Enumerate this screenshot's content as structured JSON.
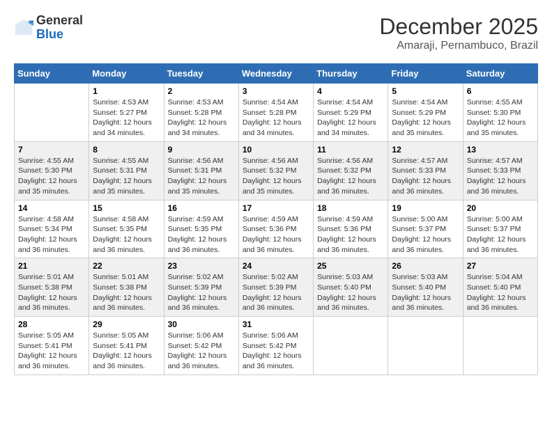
{
  "logo": {
    "general": "General",
    "blue": "Blue"
  },
  "header": {
    "title": "December 2025",
    "subtitle": "Amaraji, Pernambuco, Brazil"
  },
  "days_of_week": [
    "Sunday",
    "Monday",
    "Tuesday",
    "Wednesday",
    "Thursday",
    "Friday",
    "Saturday"
  ],
  "weeks": [
    [
      {
        "day": "",
        "sunrise": "",
        "sunset": "",
        "daylight": ""
      },
      {
        "day": "1",
        "sunrise": "Sunrise: 4:53 AM",
        "sunset": "Sunset: 5:27 PM",
        "daylight": "Daylight: 12 hours and 34 minutes."
      },
      {
        "day": "2",
        "sunrise": "Sunrise: 4:53 AM",
        "sunset": "Sunset: 5:28 PM",
        "daylight": "Daylight: 12 hours and 34 minutes."
      },
      {
        "day": "3",
        "sunrise": "Sunrise: 4:54 AM",
        "sunset": "Sunset: 5:28 PM",
        "daylight": "Daylight: 12 hours and 34 minutes."
      },
      {
        "day": "4",
        "sunrise": "Sunrise: 4:54 AM",
        "sunset": "Sunset: 5:29 PM",
        "daylight": "Daylight: 12 hours and 34 minutes."
      },
      {
        "day": "5",
        "sunrise": "Sunrise: 4:54 AM",
        "sunset": "Sunset: 5:29 PM",
        "daylight": "Daylight: 12 hours and 35 minutes."
      },
      {
        "day": "6",
        "sunrise": "Sunrise: 4:55 AM",
        "sunset": "Sunset: 5:30 PM",
        "daylight": "Daylight: 12 hours and 35 minutes."
      }
    ],
    [
      {
        "day": "7",
        "sunrise": "Sunrise: 4:55 AM",
        "sunset": "Sunset: 5:30 PM",
        "daylight": "Daylight: 12 hours and 35 minutes."
      },
      {
        "day": "8",
        "sunrise": "Sunrise: 4:55 AM",
        "sunset": "Sunset: 5:31 PM",
        "daylight": "Daylight: 12 hours and 35 minutes."
      },
      {
        "day": "9",
        "sunrise": "Sunrise: 4:56 AM",
        "sunset": "Sunset: 5:31 PM",
        "daylight": "Daylight: 12 hours and 35 minutes."
      },
      {
        "day": "10",
        "sunrise": "Sunrise: 4:56 AM",
        "sunset": "Sunset: 5:32 PM",
        "daylight": "Daylight: 12 hours and 35 minutes."
      },
      {
        "day": "11",
        "sunrise": "Sunrise: 4:56 AM",
        "sunset": "Sunset: 5:32 PM",
        "daylight": "Daylight: 12 hours and 36 minutes."
      },
      {
        "day": "12",
        "sunrise": "Sunrise: 4:57 AM",
        "sunset": "Sunset: 5:33 PM",
        "daylight": "Daylight: 12 hours and 36 minutes."
      },
      {
        "day": "13",
        "sunrise": "Sunrise: 4:57 AM",
        "sunset": "Sunset: 5:33 PM",
        "daylight": "Daylight: 12 hours and 36 minutes."
      }
    ],
    [
      {
        "day": "14",
        "sunrise": "Sunrise: 4:58 AM",
        "sunset": "Sunset: 5:34 PM",
        "daylight": "Daylight: 12 hours and 36 minutes."
      },
      {
        "day": "15",
        "sunrise": "Sunrise: 4:58 AM",
        "sunset": "Sunset: 5:35 PM",
        "daylight": "Daylight: 12 hours and 36 minutes."
      },
      {
        "day": "16",
        "sunrise": "Sunrise: 4:59 AM",
        "sunset": "Sunset: 5:35 PM",
        "daylight": "Daylight: 12 hours and 36 minutes."
      },
      {
        "day": "17",
        "sunrise": "Sunrise: 4:59 AM",
        "sunset": "Sunset: 5:36 PM",
        "daylight": "Daylight: 12 hours and 36 minutes."
      },
      {
        "day": "18",
        "sunrise": "Sunrise: 4:59 AM",
        "sunset": "Sunset: 5:36 PM",
        "daylight": "Daylight: 12 hours and 36 minutes."
      },
      {
        "day": "19",
        "sunrise": "Sunrise: 5:00 AM",
        "sunset": "Sunset: 5:37 PM",
        "daylight": "Daylight: 12 hours and 36 minutes."
      },
      {
        "day": "20",
        "sunrise": "Sunrise: 5:00 AM",
        "sunset": "Sunset: 5:37 PM",
        "daylight": "Daylight: 12 hours and 36 minutes."
      }
    ],
    [
      {
        "day": "21",
        "sunrise": "Sunrise: 5:01 AM",
        "sunset": "Sunset: 5:38 PM",
        "daylight": "Daylight: 12 hours and 36 minutes."
      },
      {
        "day": "22",
        "sunrise": "Sunrise: 5:01 AM",
        "sunset": "Sunset: 5:38 PM",
        "daylight": "Daylight: 12 hours and 36 minutes."
      },
      {
        "day": "23",
        "sunrise": "Sunrise: 5:02 AM",
        "sunset": "Sunset: 5:39 PM",
        "daylight": "Daylight: 12 hours and 36 minutes."
      },
      {
        "day": "24",
        "sunrise": "Sunrise: 5:02 AM",
        "sunset": "Sunset: 5:39 PM",
        "daylight": "Daylight: 12 hours and 36 minutes."
      },
      {
        "day": "25",
        "sunrise": "Sunrise: 5:03 AM",
        "sunset": "Sunset: 5:40 PM",
        "daylight": "Daylight: 12 hours and 36 minutes."
      },
      {
        "day": "26",
        "sunrise": "Sunrise: 5:03 AM",
        "sunset": "Sunset: 5:40 PM",
        "daylight": "Daylight: 12 hours and 36 minutes."
      },
      {
        "day": "27",
        "sunrise": "Sunrise: 5:04 AM",
        "sunset": "Sunset: 5:40 PM",
        "daylight": "Daylight: 12 hours and 36 minutes."
      }
    ],
    [
      {
        "day": "28",
        "sunrise": "Sunrise: 5:05 AM",
        "sunset": "Sunset: 5:41 PM",
        "daylight": "Daylight: 12 hours and 36 minutes."
      },
      {
        "day": "29",
        "sunrise": "Sunrise: 5:05 AM",
        "sunset": "Sunset: 5:41 PM",
        "daylight": "Daylight: 12 hours and 36 minutes."
      },
      {
        "day": "30",
        "sunrise": "Sunrise: 5:06 AM",
        "sunset": "Sunset: 5:42 PM",
        "daylight": "Daylight: 12 hours and 36 minutes."
      },
      {
        "day": "31",
        "sunrise": "Sunrise: 5:06 AM",
        "sunset": "Sunset: 5:42 PM",
        "daylight": "Daylight: 12 hours and 36 minutes."
      },
      {
        "day": "",
        "sunrise": "",
        "sunset": "",
        "daylight": ""
      },
      {
        "day": "",
        "sunrise": "",
        "sunset": "",
        "daylight": ""
      },
      {
        "day": "",
        "sunrise": "",
        "sunset": "",
        "daylight": ""
      }
    ]
  ]
}
